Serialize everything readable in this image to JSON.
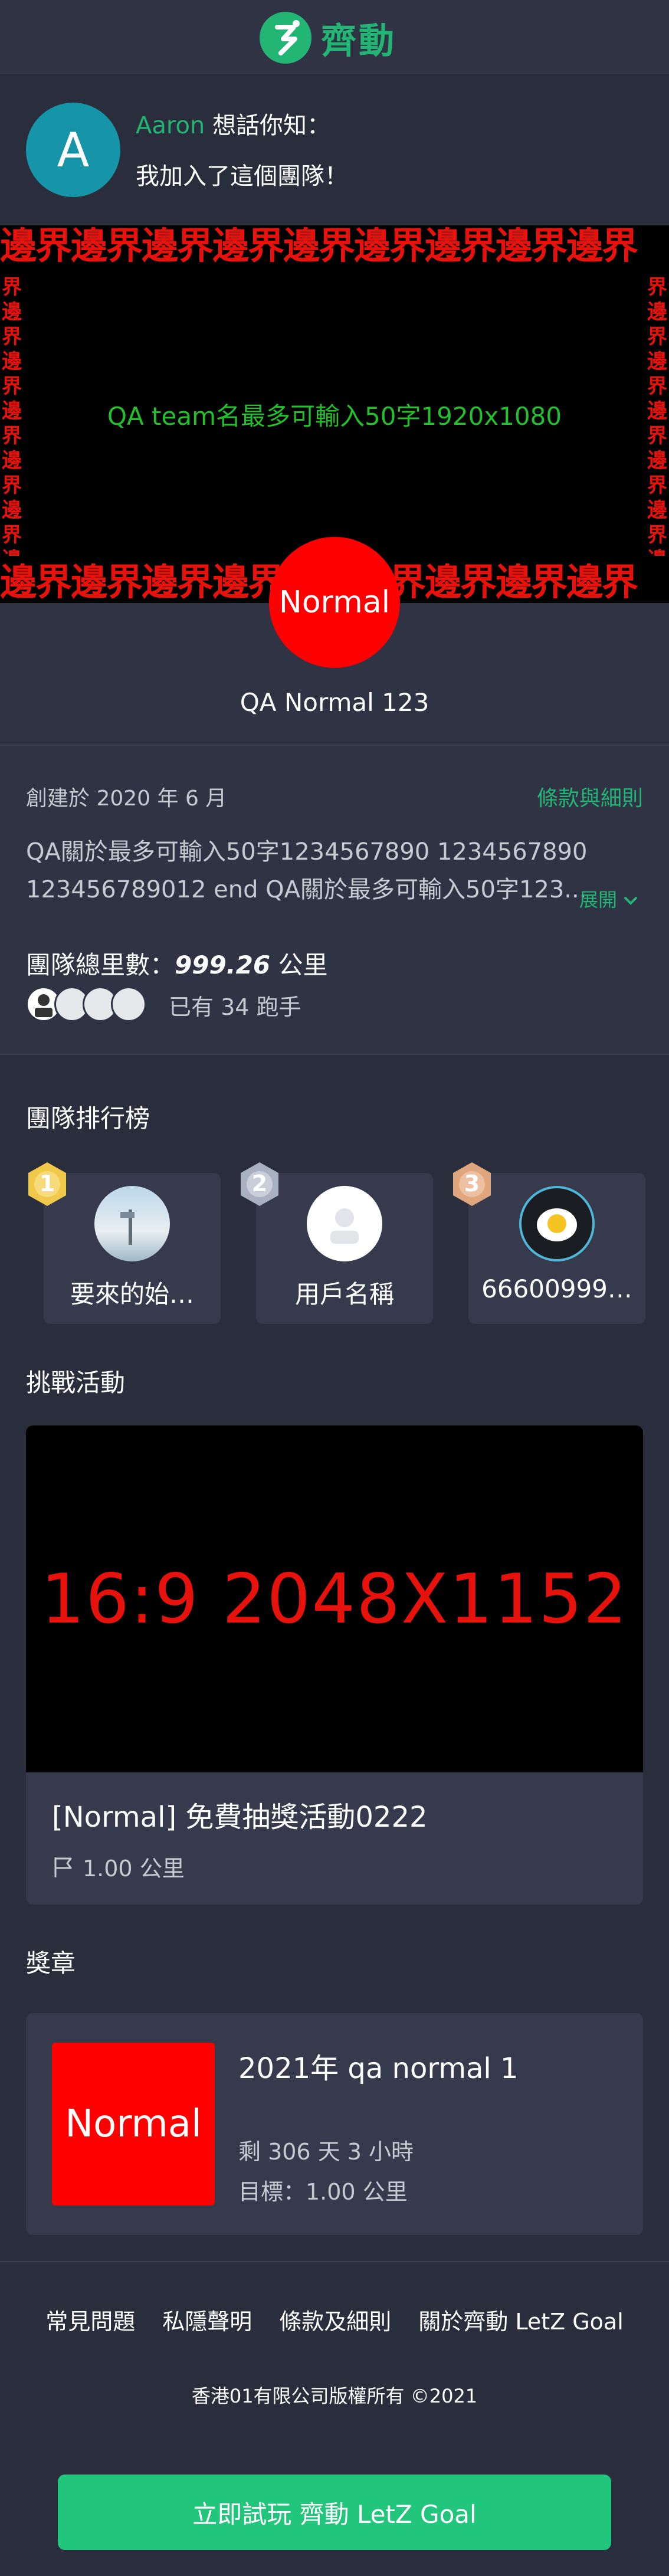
{
  "app": {
    "logo_text": "齊動",
    "brand_color": "#22b573"
  },
  "post": {
    "avatar_letter": "A",
    "author": "Aaron",
    "verb": "想話你知：",
    "message": "我加入了這個團隊！"
  },
  "banner": {
    "border_text": "邊界邊界邊界邊界邊界邊界邊界邊界邊界",
    "side_text": "界邊界邊界邊界邊界邊界邊界",
    "center_text": "QA team名最多可輸入50字1920x1080"
  },
  "team": {
    "level_label": "Normal",
    "name": "QA Normal 123",
    "created": "創建於 2020 年 6 月",
    "terms_link": "條款與細則",
    "description": "QA關於最多可輸入50字1234567890 1234567890 123456789012 end QA關於最多可輸入50字123...",
    "expand_label": "展開",
    "total_label": "團隊總里數：",
    "total_value": "999.26",
    "total_unit": "公里",
    "runners_text": "已有 34 跑手"
  },
  "ranking": {
    "title": "團隊排行榜",
    "items": [
      {
        "rank": "1",
        "name": "要來的始…"
      },
      {
        "rank": "2",
        "name": "用戶名稱"
      },
      {
        "rank": "3",
        "name": "66600999…"
      }
    ]
  },
  "challenge": {
    "title": "挑戰活動",
    "image_text": "16:9 2048X1152",
    "name": "[Normal] 免費抽獎活動0222",
    "distance": "1.00 公里"
  },
  "badges": {
    "title": "獎章",
    "badge_label": "Normal",
    "name": "2021年 qa normal 1",
    "remaining": "剩 306 天 3 小時",
    "target": "目標：1.00 公里"
  },
  "footer": {
    "links": [
      "常見問題",
      "私隱聲明",
      "條款及細則",
      "關於齊動 LetZ Goal"
    ],
    "copyright": "香港01有限公司版權所有 ©2021",
    "cta": "立即試玩 齊動 LetZ Goal"
  }
}
